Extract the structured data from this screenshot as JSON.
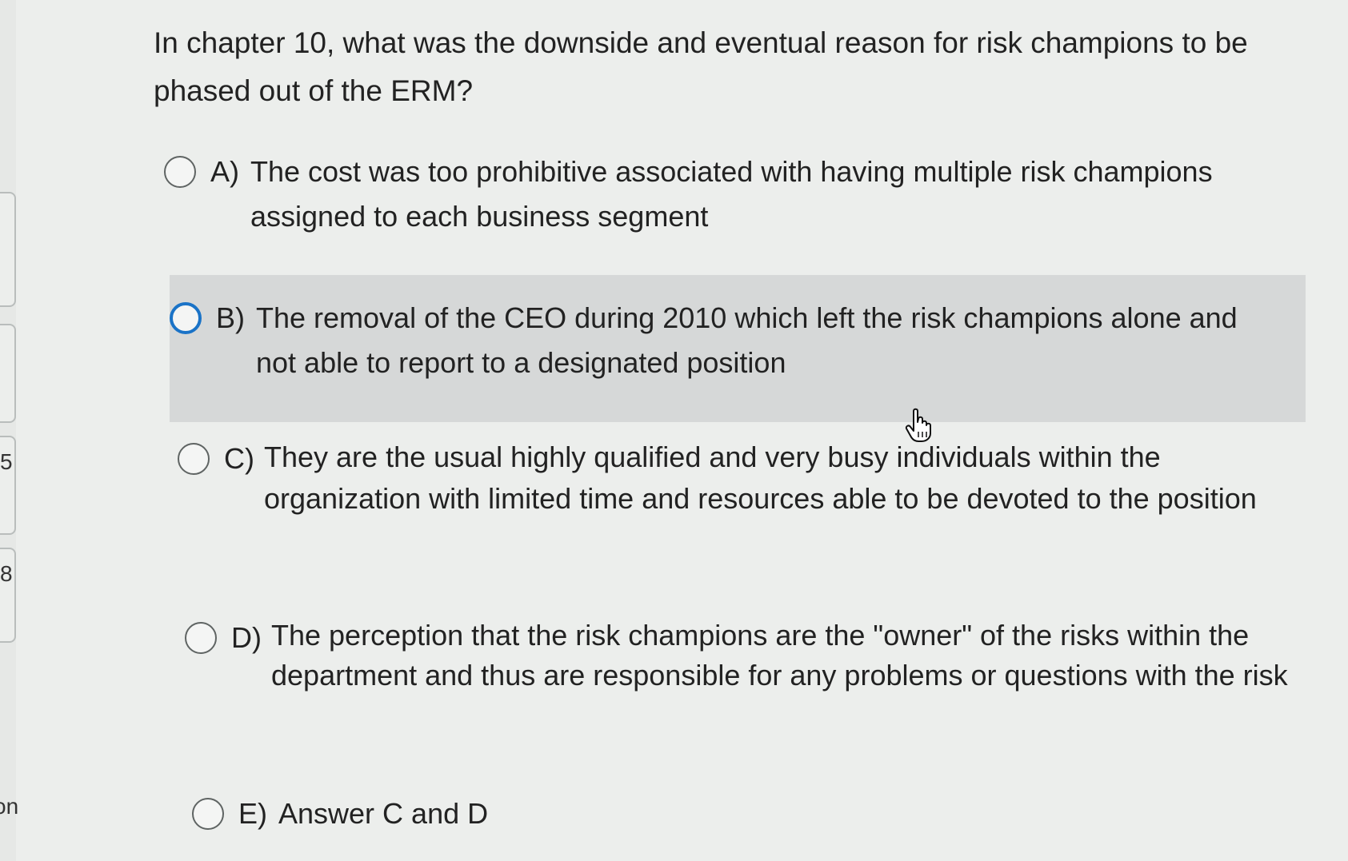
{
  "sidebar": {
    "fragments": [
      "5",
      "8",
      "on"
    ]
  },
  "question": {
    "text": "In chapter 10, what was the downside and eventual reason for risk champions to be phased out of the ERM?"
  },
  "options": [
    {
      "letter": "A)",
      "text": "The cost was too prohibitive associated with having multiple risk champions assigned to each business segment",
      "selected": false
    },
    {
      "letter": "B)",
      "text": "The removal of the CEO during 2010 which left the risk champions alone and not able to report to a designated position",
      "selected": false,
      "hovered": true
    },
    {
      "letter": "C)",
      "text": "They are the usual highly qualified and very busy individuals within the organization with limited time and resources able to be devoted to the position",
      "selected": false
    },
    {
      "letter": "D)",
      "text": "The perception that the risk champions are the \"owner\" of the risks within the department and thus are responsible for any problems or questions with the risk",
      "selected": false
    },
    {
      "letter": "E)",
      "text": "Answer C and D",
      "selected": false
    }
  ],
  "colors": {
    "background": "#eceeec",
    "highlight": "#d6d8d8",
    "focus_ring": "#1a73c7"
  },
  "icons": {
    "cursor": "hand-pointer-icon"
  }
}
